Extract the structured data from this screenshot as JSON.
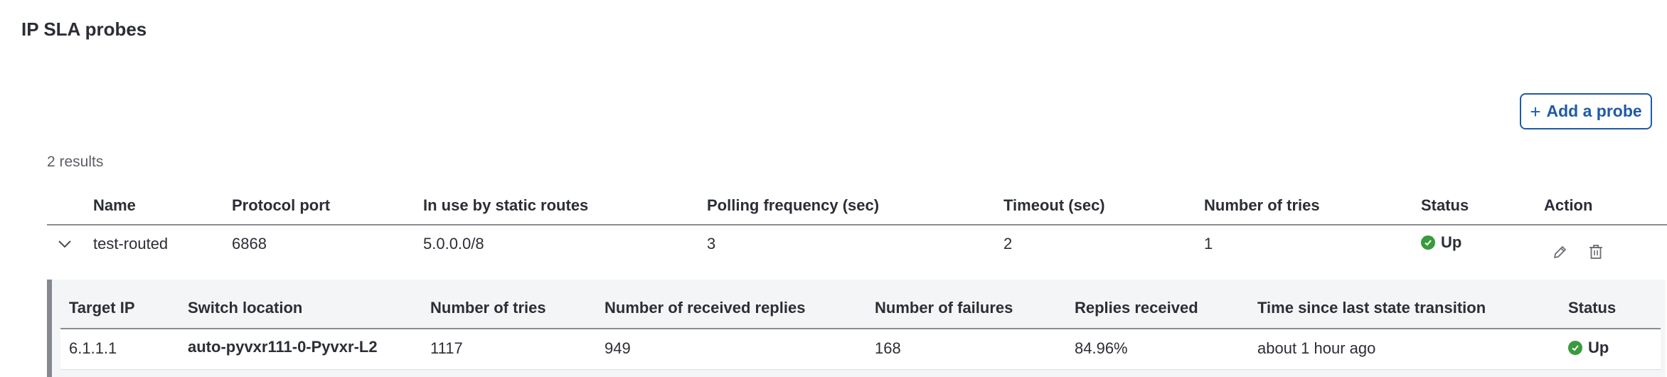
{
  "page": {
    "title": "IP SLA probes"
  },
  "toolbar": {
    "add_probe_icon": "plus-icon",
    "add_probe_label": "Add a probe"
  },
  "results": {
    "count_text": "2 results"
  },
  "probes_table": {
    "columns": [
      "Name",
      "Protocol port",
      "In use by static routes",
      "Polling frequency (sec)",
      "Timeout (sec)",
      "Number of tries",
      "Status",
      "Action"
    ],
    "rows": [
      {
        "expand_icon": "chevron-down-icon",
        "name": "test-routed",
        "protocol_port": "6868",
        "in_use_by_static_routes": "5.0.0.0/8",
        "polling_frequency": "3",
        "timeout": "2",
        "number_of_tries": "1",
        "status": "Up",
        "status_icon": "check-circle-icon",
        "status_color": "#3a9a3e",
        "actions": [
          "edit-icon",
          "trash-icon"
        ]
      }
    ]
  },
  "detail_table": {
    "columns": [
      "Target IP",
      "Switch location",
      "Number of tries",
      "Number of received replies",
      "Number of failures",
      "Replies received",
      "Time since last state transition",
      "Status"
    ],
    "rows": [
      {
        "target_ip": "6.1.1.1",
        "switch_location": "auto-pyvxr111-0-Pyvxr-L2",
        "number_of_tries": "1117",
        "received_replies": "949",
        "failures": "168",
        "replies_received": "84.96%",
        "time_since_transition": "about 1 hour ago",
        "status": "Up",
        "status_icon": "check-circle-icon",
        "status_color": "#3a9a3e"
      }
    ]
  },
  "colors": {
    "accent": "#1f5aa8",
    "success": "#3a9a3e"
  }
}
